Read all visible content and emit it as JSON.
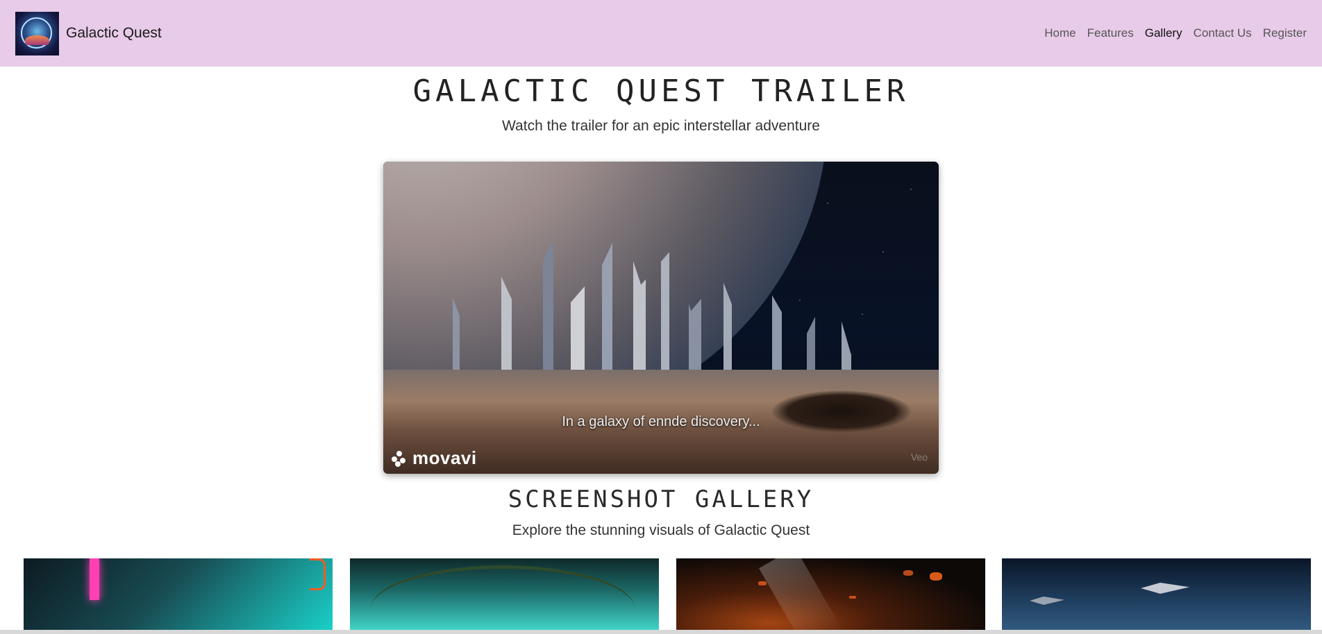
{
  "app": {
    "name": "Galactic Quest"
  },
  "nav": {
    "items": [
      {
        "label": "Home"
      },
      {
        "label": "Features"
      },
      {
        "label": "Gallery",
        "active": true
      },
      {
        "label": "Contact Us"
      },
      {
        "label": "Register"
      }
    ]
  },
  "hero": {
    "title": "GALACTIC QUEST TRAILER",
    "subtitle": "Watch the trailer for an epic interstellar adventure"
  },
  "video": {
    "caption": "In a galaxy of ennde discovery...",
    "watermark": "movavi",
    "corner_mark": "Veo"
  },
  "gallery": {
    "title": "SCREENSHOT GALLERY",
    "subtitle": "Explore the stunning visuals of Galactic Quest"
  },
  "colors": {
    "navbar_bg": "#e8cbe8",
    "page_bg": "#ffffff",
    "text": "#222222"
  }
}
